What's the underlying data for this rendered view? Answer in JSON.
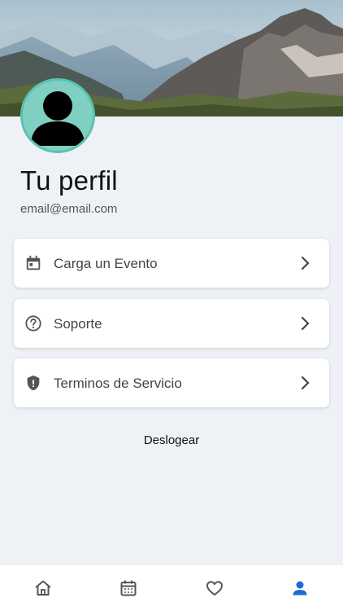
{
  "profile": {
    "title": "Tu perfil",
    "email": "email@email.com"
  },
  "menu": {
    "items": [
      {
        "label": "Carga un Evento",
        "icon": "calendar-icon"
      },
      {
        "label": "Soporte",
        "icon": "help-circle-icon"
      },
      {
        "label": "Terminos de Servicio",
        "icon": "shield-icon"
      }
    ]
  },
  "logout_label": "Deslogear",
  "tabbar": {
    "tabs": [
      {
        "icon": "home-icon",
        "active": false
      },
      {
        "icon": "calendar-icon",
        "active": false
      },
      {
        "icon": "heart-icon",
        "active": false
      },
      {
        "icon": "person-icon",
        "active": true
      }
    ]
  },
  "colors": {
    "background": "#eef2f7",
    "accent": "#1e6ad6",
    "avatar_ring": "#5bc2b0",
    "icon_gray": "#555555"
  }
}
